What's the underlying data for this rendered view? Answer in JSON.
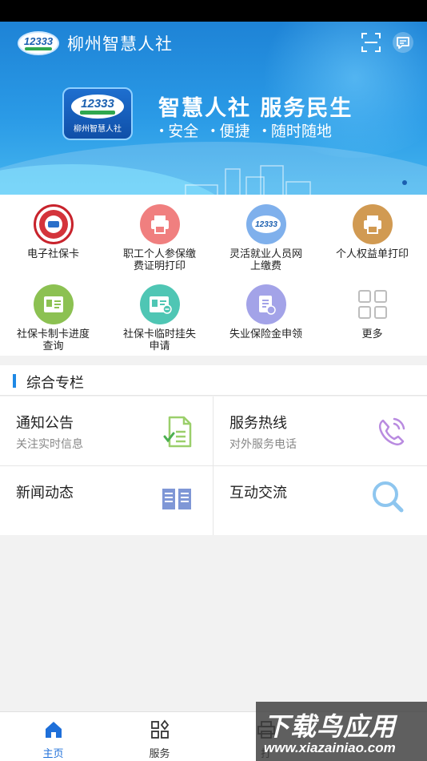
{
  "header": {
    "logo_number": "12333",
    "app_title": "柳州智慧人社"
  },
  "banner": {
    "promo_logo_number": "12333",
    "promo_logo_name": "柳州智慧人社",
    "slogan": "智慧人社  服务民生",
    "tags": [
      "安全",
      "便捷",
      "随时随地"
    ]
  },
  "services": [
    {
      "label": "电子社保卡",
      "icon": "social-security-card-icon",
      "color": "#c8232c"
    },
    {
      "label": "职工个人参保缴费证明打印",
      "icon": "printer-icon",
      "color": "#f07f7f"
    },
    {
      "label": "灵活就业人员网上缴费",
      "icon": "12333-icon",
      "color": "#7fb0ec"
    },
    {
      "label": "个人权益单打印",
      "icon": "printer-icon",
      "color": "#d19a52"
    },
    {
      "label": "社保卡制卡进度查询",
      "icon": "id-card-icon",
      "color": "#8cc152"
    },
    {
      "label": "社保卡临时挂失申请",
      "icon": "id-card-minus-icon",
      "color": "#4fc6b4"
    },
    {
      "label": "失业保险金申领",
      "icon": "document-icon",
      "color": "#a3a3e8"
    },
    {
      "label": "更多",
      "icon": "more-grid-icon",
      "color": "#bdbdbd"
    }
  ],
  "section": {
    "title": "综合专栏"
  },
  "cards": [
    {
      "title": "通知公告",
      "subtitle": "关注实时信息",
      "icon": "notice-doc-icon"
    },
    {
      "title": "服务热线",
      "subtitle": "对外服务电话",
      "icon": "phone-icon"
    },
    {
      "title": "新闻动态",
      "subtitle": "",
      "icon": "book-icon"
    },
    {
      "title": "互动交流",
      "subtitle": "",
      "icon": "search-icon"
    }
  ],
  "tabs": [
    {
      "label": "主页",
      "icon": "home-icon",
      "active": true
    },
    {
      "label": "服务",
      "icon": "apps-icon",
      "active": false
    },
    {
      "label": "打",
      "icon": "print-icon",
      "active": false
    }
  ],
  "watermark": {
    "line1": "下载鸟应用",
    "line2": "www.xiazainiao.com"
  },
  "colors": {
    "accent": "#1e6fd9",
    "banner_top": "#1e83d6",
    "banner_bottom": "#45b6ef"
  }
}
